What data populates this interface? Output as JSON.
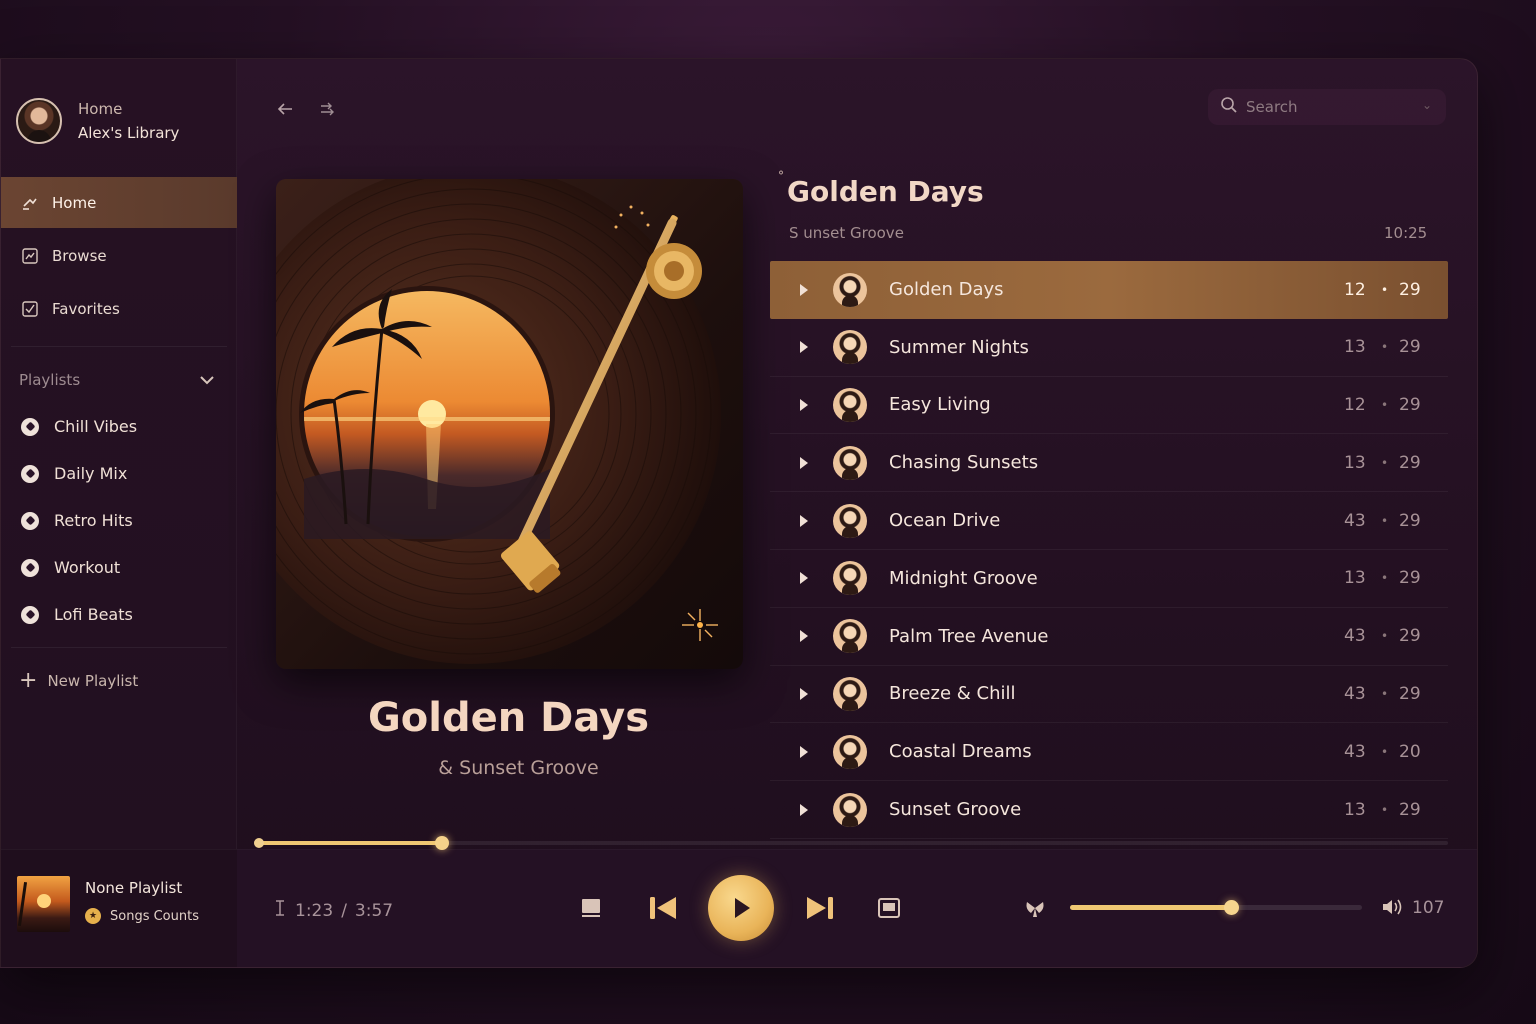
{
  "profile": {
    "sub": "Home",
    "name": "Alex's Library"
  },
  "nav": [
    {
      "label": "Home",
      "icon": "home-icon",
      "active": true
    },
    {
      "label": "Browse",
      "icon": "browse-icon",
      "active": false
    },
    {
      "label": "Favorites",
      "icon": "favorites-icon",
      "active": false
    }
  ],
  "playlists": {
    "header": "Playlists",
    "items": [
      "Chill Vibes",
      "Daily Mix",
      "Retro Hits",
      "Workout",
      "Lofi Beats"
    ],
    "new_label": "New Playlist"
  },
  "search": {
    "placeholder": "Search"
  },
  "album": {
    "title": "Golden Days",
    "subtitle": "& Sunset Groove"
  },
  "list": {
    "title": "Golden Days",
    "subtitle": "S unset Groove",
    "duration": "10:25",
    "tracks": [
      {
        "name": "Golden Days",
        "num": "12",
        "num2": "29",
        "active": true
      },
      {
        "name": "Summer Nights",
        "num": "13",
        "num2": "29"
      },
      {
        "name": "Easy Living",
        "num": "12",
        "num2": "29"
      },
      {
        "name": "Chasing Sunsets",
        "num": "13",
        "num2": "29"
      },
      {
        "name": "Ocean Drive",
        "num": "43",
        "num2": "29"
      },
      {
        "name": "Midnight Groove",
        "num": "13",
        "num2": "29"
      },
      {
        "name": "Palm Tree Avenue",
        "num": "43",
        "num2": "29"
      },
      {
        "name": "Breeze & Chill",
        "num": "43",
        "num2": "29"
      },
      {
        "name": "Coastal Dreams",
        "num": "43",
        "num2": "20"
      },
      {
        "name": "Sunset Groove",
        "num": "13",
        "num2": "29"
      }
    ]
  },
  "mini": {
    "title": "None Playlist",
    "sub": "Songs Counts"
  },
  "player": {
    "elapsed": "1:23",
    "separator": "/",
    "total": "3:57",
    "progress_fraction": 0.155,
    "volume_fraction": 0.55,
    "volume_label": "107"
  },
  "colors": {
    "accent": "#f0c873",
    "active_row": "#9b6a3e",
    "sidebar_active": "#6b4532"
  }
}
